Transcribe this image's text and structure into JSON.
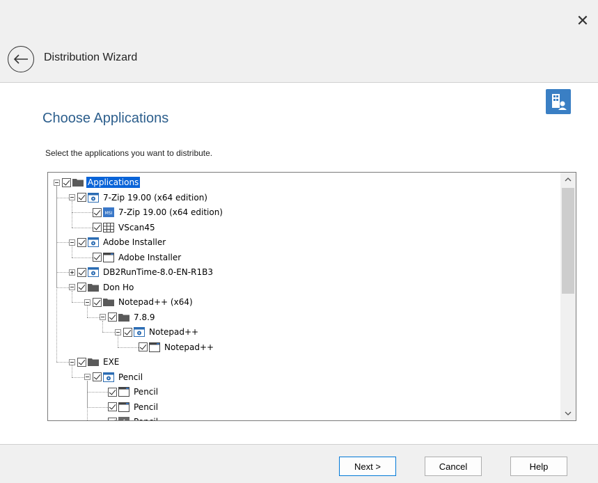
{
  "window": {
    "title": "Distribution Wizard",
    "close_icon": "close-icon",
    "back_icon": "back-arrow-icon"
  },
  "page": {
    "title": "Choose Applications",
    "instruction": "Select the applications you want to distribute.",
    "corner_icon": "building-user-icon"
  },
  "tree": {
    "nodes": [
      {
        "label": "Applications",
        "level": 0,
        "icon": "folder-icon",
        "expander": "minus",
        "checked": true,
        "selected": true
      },
      {
        "label": "7-Zip 19.00 (x64 edition)",
        "level": 1,
        "icon": "gear-package-icon",
        "expander": "minus",
        "checked": true
      },
      {
        "label": "7-Zip 19.00 (x64 edition)",
        "level": 2,
        "icon": "msi-icon",
        "expander": "none",
        "checked": true
      },
      {
        "label": "VScan45",
        "level": 2,
        "icon": "grid-icon",
        "expander": "none",
        "checked": true
      },
      {
        "label": "Adobe Installer",
        "level": 1,
        "icon": "gear-package-icon",
        "expander": "minus",
        "checked": true
      },
      {
        "label": "Adobe Installer",
        "level": 2,
        "icon": "window-icon",
        "expander": "none",
        "checked": true
      },
      {
        "label": "DB2RunTime-8.0-EN-R1B3",
        "level": 1,
        "icon": "gear-package-icon",
        "expander": "plus",
        "checked": true
      },
      {
        "label": "Don Ho",
        "level": 1,
        "icon": "folder-icon",
        "expander": "minus",
        "checked": true
      },
      {
        "label": "Notepad++ (x64)",
        "level": 2,
        "icon": "folder-icon",
        "expander": "minus",
        "checked": true
      },
      {
        "label": "7.8.9",
        "level": 3,
        "icon": "folder-icon",
        "expander": "minus",
        "checked": true
      },
      {
        "label": "Notepad++",
        "level": 4,
        "icon": "gear-package-icon",
        "expander": "minus",
        "checked": true
      },
      {
        "label": "Notepad++",
        "level": 5,
        "icon": "window-icon",
        "expander": "none",
        "checked": true
      },
      {
        "label": "EXE",
        "level": 1,
        "icon": "folder-icon",
        "expander": "minus",
        "checked": true
      },
      {
        "label": "Pencil",
        "level": 2,
        "icon": "gear-package-icon",
        "expander": "minus",
        "checked": true
      },
      {
        "label": "Pencil",
        "level": 3,
        "icon": "window-icon",
        "expander": "none",
        "checked": true
      },
      {
        "label": "Pencil",
        "level": 3,
        "icon": "window-icon",
        "expander": "none",
        "checked": true
      },
      {
        "label": "Pencil",
        "level": 3,
        "icon": "shortcut-icon",
        "expander": "none",
        "checked": true
      }
    ]
  },
  "scrollbar": {
    "up_icon": "chevron-up-icon",
    "down_icon": "chevron-down-icon",
    "position": 0.0,
    "visible_fraction": 0.45
  },
  "buttons": {
    "next": "Next >",
    "cancel": "Cancel",
    "help": "Help"
  }
}
